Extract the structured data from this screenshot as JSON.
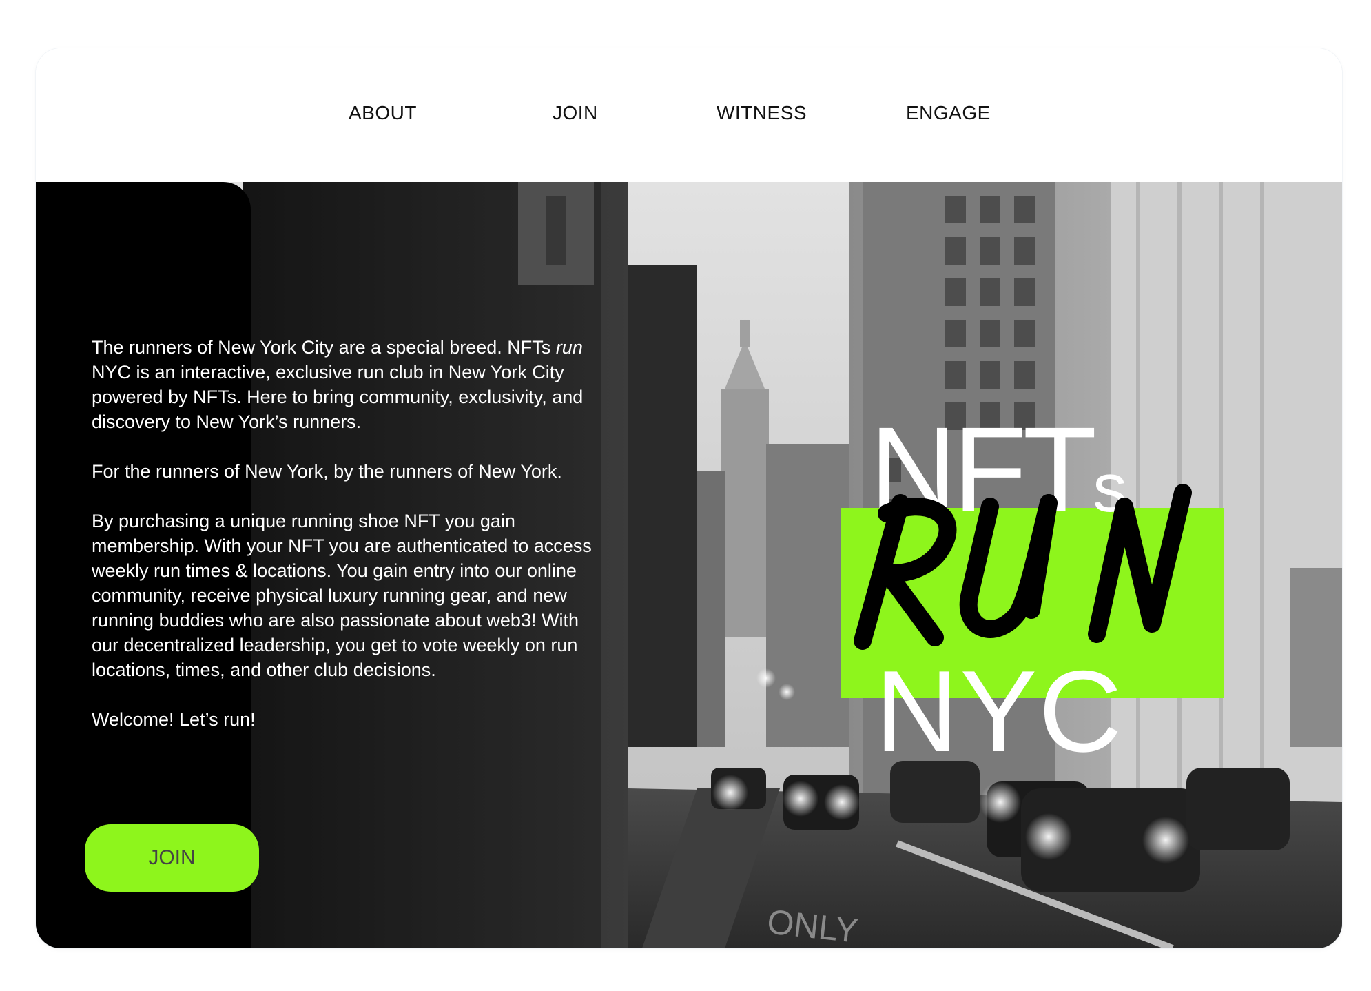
{
  "nav": {
    "items": [
      {
        "label": "ABOUT"
      },
      {
        "label": "JOIN"
      },
      {
        "label": "WITNESS"
      },
      {
        "label": "ENGAGE"
      }
    ]
  },
  "hero": {
    "paragraph1_a": "The runners of New York City are a special breed. NFTs ",
    "paragraph1_em": "run",
    "paragraph1_b": " NYC is an interactive, exclusive run club in New York City powered by NFTs. Here to bring community, exclusivity, and discovery to New York’s runners.",
    "paragraph2": "For the runners of New York, by the runners of New York.",
    "paragraph3": "By purchasing a unique running shoe NFT you gain membership. With your NFT you are authenticated to access weekly run times & locations. You gain entry into our online community, receive physical luxury running gear, and new running buddies who are also passionate about web3! With our decentralized leadership, you get to vote weekly on run locations, times, and other club decisions.",
    "paragraph4": "Welcome! Let’s run!",
    "join_button": "JOIN"
  },
  "logo": {
    "line1_main": "NFT",
    "line1_small": "s",
    "line2": "RUN",
    "line3": "NYC"
  },
  "colors": {
    "accent": "#8ef51c",
    "panel": "#000000",
    "text_dark": "#111111"
  }
}
